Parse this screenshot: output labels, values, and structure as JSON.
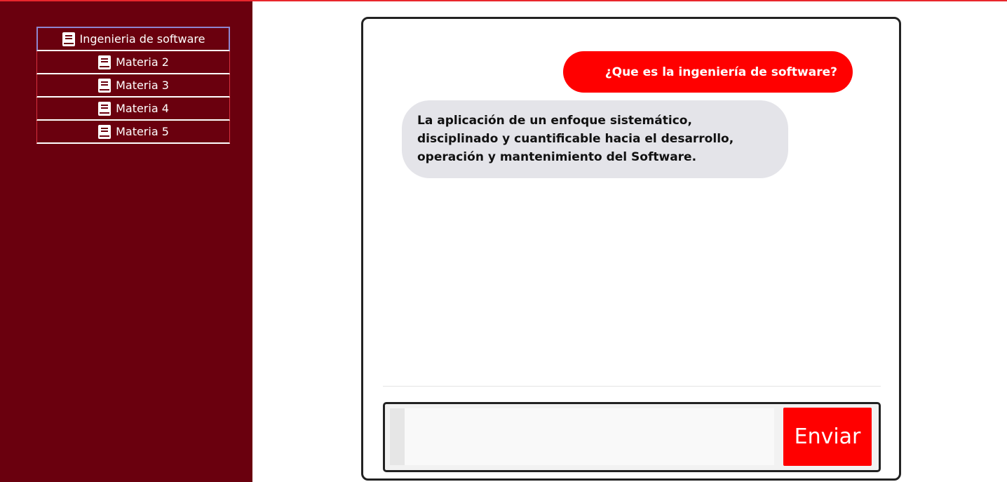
{
  "sidebar": {
    "items": [
      {
        "label": "Ingenieria de software",
        "icon": "book-icon",
        "active": true
      },
      {
        "label": "Materia 2",
        "icon": "book-icon",
        "active": false
      },
      {
        "label": "Materia 3",
        "icon": "book-icon",
        "active": false
      },
      {
        "label": "Materia 4",
        "icon": "book-icon",
        "active": false
      },
      {
        "label": "Materia 5",
        "icon": "book-icon",
        "active": false
      }
    ]
  },
  "chat": {
    "messages": [
      {
        "role": "user",
        "text": "¿Que es la ingeniería de software?"
      },
      {
        "role": "bot",
        "text": "La aplicación de un enfoque sistemático, disciplinado y cuantificable hacia el desarrollo, operación y mantenimiento del Software."
      }
    ]
  },
  "composer": {
    "value": "",
    "placeholder": "",
    "send_label": "Enviar"
  },
  "colors": {
    "sidebar_bg": "#6a000e",
    "accent": "#ff0000",
    "bot_bubble": "#e4e4e9"
  }
}
